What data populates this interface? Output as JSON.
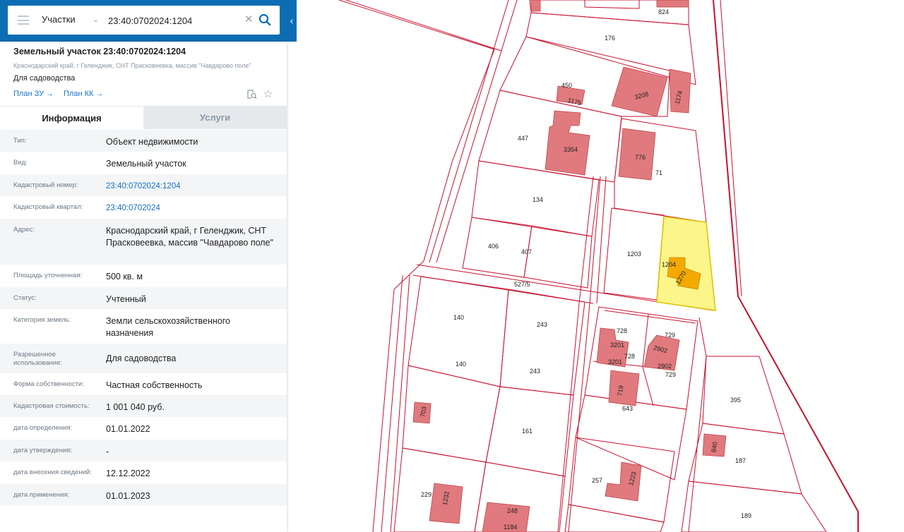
{
  "search": {
    "layer": "Участки",
    "query": "23:40:0702024:1204"
  },
  "object": {
    "title": "Земельный участок 23:40:0702024:1204",
    "address": "Краснодарский край, г Геленджик, СНТ Прасковеевка, массив \"Чавдарово поле\"",
    "use": "Для садоводства",
    "plan_zu": "План ЗУ →",
    "plan_kk": "План КК →"
  },
  "tabs": {
    "info": "Информация",
    "services": "Услуги"
  },
  "info": [
    {
      "label": "Тип:",
      "value": "Объект недвижимости"
    },
    {
      "label": "Вид:",
      "value": "Земельный участок"
    },
    {
      "label": "Кадастровый номер:",
      "value": "23:40:0702024:1204"
    },
    {
      "label": "Кадастровый квартал:",
      "value": "23:40:0702024"
    },
    {
      "label": "Адрес:",
      "value": "Краснодарский край, г Геленджик, СНТ Прасковеевка, массив \"Чавдарово поле\""
    },
    {
      "label": "Площадь уточненная:",
      "value": "500 кв. м"
    },
    {
      "label": "Статус:",
      "value": "Учтенный"
    },
    {
      "label": "Категория земель:",
      "value": "Земли сельскохозяйственного назначения"
    },
    {
      "label": "Разрешенное использование:",
      "value": "Для садоводства"
    },
    {
      "label": "Форма собственности:",
      "value": "Частная собственность"
    },
    {
      "label": "Кадастровая стоимость:",
      "value": "1 001 040 руб."
    },
    {
      "label": "дата определения:",
      "value": "01.01.2022"
    },
    {
      "label": "дата утверждения:",
      "value": "-"
    },
    {
      "label": "дата внесения сведений:",
      "value": "12.12.2022"
    },
    {
      "label": "дата применения:",
      "value": "01.01.2023"
    }
  ],
  "map": {
    "colors": {
      "parcel_border": "#c8102e",
      "building_fill": "#e07a7e",
      "selected_fill": "#fbf58a",
      "selected_building": "#f2a900"
    },
    "labels": {
      "l824": "824",
      "l176": "176",
      "l450": "450",
      "l1175": "1175",
      "l3208": "3208",
      "l1174": "1174",
      "l447": "447",
      "l3354": "3354",
      "l776": "776",
      "l71": "71",
      "l134": "134",
      "l406": "406",
      "l407": "407",
      "l1203": "1203",
      "l1204": "1204",
      "l1270": "1270",
      "l527": "527/5",
      "l140a": "140",
      "l243a": "243",
      "l140b": "140",
      "l243b": "243",
      "l728a": "728",
      "l3201a": "3201",
      "l728b": "728",
      "l3201b": "3201",
      "l729a": "729",
      "l2902a": "2902",
      "l2902b": "2902",
      "l729b": "729",
      "l703": "703",
      "l161": "161",
      "l719": "719",
      "l643": "643",
      "l395": "395",
      "l840": "840",
      "l187": "187",
      "l229": "229",
      "l1232": "1232",
      "l248": "248",
      "l1184": "1184",
      "l257": "257",
      "l1223": "1223",
      "l189": "189"
    }
  }
}
